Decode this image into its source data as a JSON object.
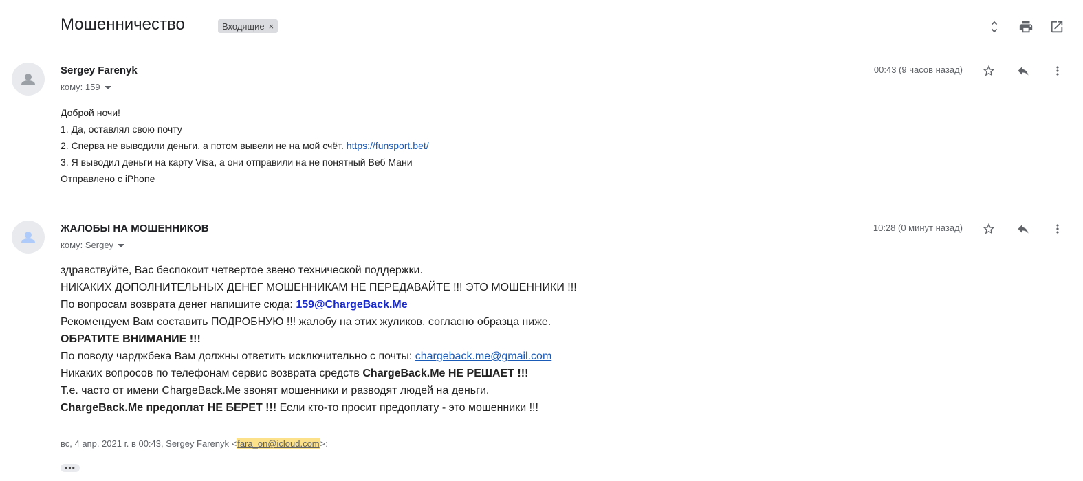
{
  "header": {
    "subject": "Мошенничество",
    "label": "Входящие",
    "label_close": "×"
  },
  "messages": [
    {
      "sender": "Sergey Farenyk",
      "to": "кому: 159",
      "time": "00:43 (9 часов назад)",
      "body": {
        "line1": "Доброй ночи!",
        "line2": "1. Да, оставлял свою почту",
        "line3_text": "2. Сперва не выводили деньги, а потом вывели не на мой счёт. ",
        "line3_link": "https://funsport.bet/",
        "line4": "3. Я выводил деньги на карту Visa, а они отправили на не понятный Веб Мани",
        "line5": "Отправлено с iPhone"
      }
    },
    {
      "sender": "ЖАЛОБЫ НА МОШЕННИКОВ",
      "to": "кому: Sergey",
      "time": "10:28 (0 минут назад)",
      "body": {
        "line1": "здравствуйте, Вас беспокоит четвертое звено технической поддержки.",
        "line2": "НИКАКИХ ДОПОЛНИТЕЛЬНЫХ ДЕНЕГ МОШЕННИКАМ НЕ ПЕРЕДАВАЙТЕ !!! ЭТО МОШЕННИКИ !!!",
        "line3_text": "По вопросам возврата денег напишите сюда: ",
        "line3_email": "159@ChargeBack.Me",
        "line4": "Рекомендуем Вам составить ПОДРОБНУЮ !!! жалобу на этих жуликов, согласно образца ниже.",
        "line5": "ОБРАТИТЕ ВНИМАНИЕ !!!",
        "line6_text": "По поводу чарджбека Вам должны ответить исключительно с почты: ",
        "line6_link": "chargeback.me@gmail.com",
        "line7_text": "Никаких вопросов по телефонам сервис возврата средств ",
        "line7_bold": "ChargeBack.Me НЕ РЕШАЕТ !!!",
        "line8": "Т.е. часто от имени ChargeBack.Me звонят мошенники и разводят людей на деньги.",
        "line9_bold": "ChargeBack.Me предоплат НЕ БЕРЕТ !!!",
        "line9_text": " Если кто-то просит предоплату - это мошенники !!!"
      },
      "quote": {
        "prefix": "вс, 4 апр. 2021 г. в 00:43, Sergey Farenyk <",
        "email": "fara_on@icloud.com",
        "suffix": ">:"
      },
      "show_trimmed": "•••"
    }
  ]
}
